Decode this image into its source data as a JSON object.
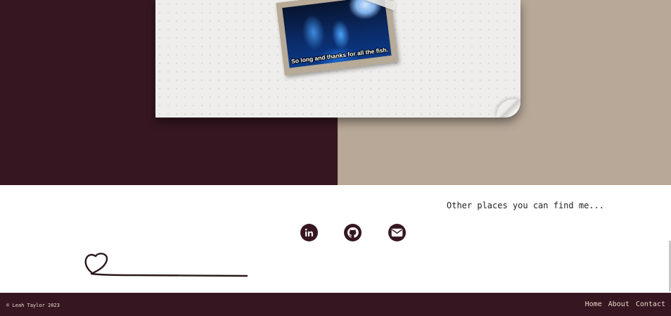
{
  "hero": {
    "photo_caption": "So long and thanks for all the fish."
  },
  "find_me": {
    "heading": "Other places you can find me...",
    "links": [
      {
        "icon": "linkedin-icon"
      },
      {
        "icon": "github-icon"
      },
      {
        "icon": "email-icon"
      }
    ]
  },
  "footer": {
    "copyright": "© Leah Taylor 2023",
    "nav": [
      "Home",
      "About",
      "Contact"
    ]
  },
  "colors": {
    "brand_dark": "#361721",
    "taupe": "#b8a898",
    "paper": "#eeedeb",
    "footer_text": "#e7d9c9"
  }
}
